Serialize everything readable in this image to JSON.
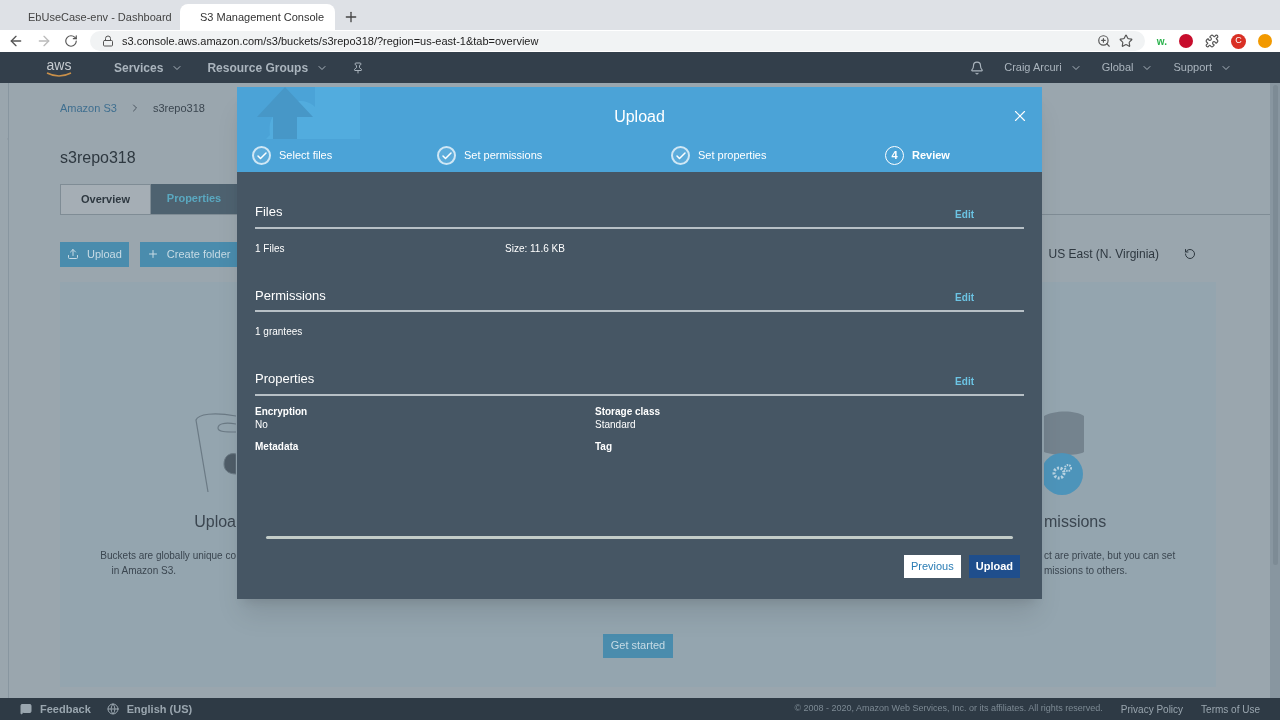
{
  "browser": {
    "tabs": [
      {
        "title": "EbUseCase-env - Dashboard",
        "selected": false
      },
      {
        "title": "S3 Management Console",
        "selected": true
      }
    ],
    "url": "s3.console.aws.amazon.com/s3/buckets/s3repo318/?region=us-east-1&tab=overview",
    "extension_label": "w.",
    "profile_initial": "C"
  },
  "aws_nav": {
    "logo": "aws",
    "menus": [
      "Services",
      "Resource Groups"
    ],
    "user": "Craig Arcuri",
    "region_menu": "Global",
    "support": "Support"
  },
  "page": {
    "breadcrumb": [
      "Amazon S3",
      "s3repo318"
    ],
    "bucket_title": "s3repo318",
    "tabs": [
      {
        "label": "Overview",
        "selected": true
      },
      {
        "label": "Properties",
        "selected": false
      }
    ],
    "actions": [
      "Upload",
      "Create folder"
    ],
    "region": "US East (N. Virginia)",
    "left_card": {
      "title": "Uploa",
      "text": [
        "Buckets are globally unique co",
        "in Amazon S3."
      ]
    },
    "right_card": {
      "title": "missions",
      "text": [
        "ct are private, but you can set",
        "missions to others."
      ]
    },
    "get_started": "Get started"
  },
  "modal": {
    "title": "Upload",
    "steps": [
      {
        "label": "Select files",
        "completed": true
      },
      {
        "label": "Set permissions",
        "completed": true
      },
      {
        "label": "Set properties",
        "completed": true
      },
      {
        "label": "Review",
        "completed": false,
        "number": "4"
      }
    ],
    "sections": [
      {
        "title": "Files",
        "edit": "Edit",
        "kind": "pair",
        "items": [
          "1 Files",
          "Size: 11.6 KB"
        ]
      },
      {
        "title": "Permissions",
        "edit": "Edit",
        "kind": "pair",
        "items": [
          "1 grantees"
        ]
      },
      {
        "title": "Properties",
        "edit": "Edit",
        "kind": "fields",
        "fields": [
          {
            "label": "Encryption",
            "value": "No"
          },
          {
            "label": "Storage class",
            "value": "Standard"
          },
          {
            "label": "Metadata"
          },
          {
            "label": "Tag"
          }
        ]
      }
    ],
    "buttons": [
      {
        "label": "Previous",
        "kind": "secondary"
      },
      {
        "label": "Upload",
        "kind": "primary"
      }
    ]
  },
  "footer": {
    "feedback": "Feedback",
    "language": "English (US)",
    "copyright": "© 2008 - 2020, Amazon Web Services, Inc. or its affiliates. All rights reserved.",
    "links": [
      "Privacy Policy",
      "Terms of Use"
    ]
  }
}
